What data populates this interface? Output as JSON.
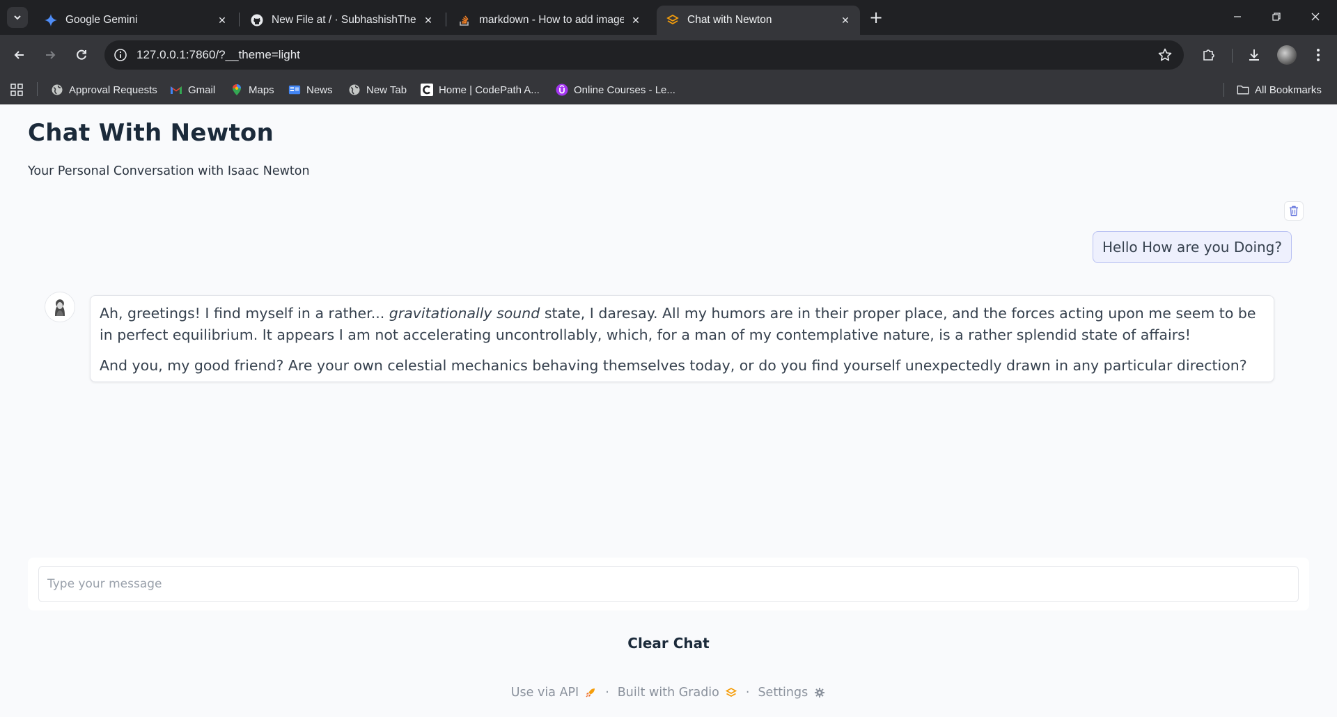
{
  "browser": {
    "tabs": [
      {
        "title": "Google Gemini",
        "icon": "gemini-icon",
        "active": false
      },
      {
        "title": "New File at / · SubhashishTheC",
        "icon": "github-icon",
        "active": false
      },
      {
        "title": "markdown - How to add image",
        "icon": "stackoverflow-icon",
        "active": false
      },
      {
        "title": "Chat with Newton",
        "icon": "gradio-icon",
        "active": true
      }
    ],
    "url": "127.0.0.1:7860/?__theme=light",
    "bookmarks": [
      {
        "label": "Approval Requests",
        "icon": "globe-icon"
      },
      {
        "label": "Gmail",
        "icon": "gmail-icon"
      },
      {
        "label": "Maps",
        "icon": "maps-icon"
      },
      {
        "label": "News",
        "icon": "news-icon"
      },
      {
        "label": "New Tab",
        "icon": "globe-icon"
      },
      {
        "label": "Home | CodePath A...",
        "icon": "codepath-icon"
      },
      {
        "label": "Online Courses - Le...",
        "icon": "udemy-icon"
      }
    ],
    "all_bookmarks_label": "All Bookmarks"
  },
  "app": {
    "title": "Chat With Newton",
    "subtitle": "Your Personal Conversation with Isaac Newton",
    "chat": {
      "user_message": "Hello How are you Doing?",
      "bot_message": {
        "p1_before": "Ah, greetings! I find myself in a rather... ",
        "p1_emphasis": "gravitationally sound",
        "p1_after": " state, I daresay. All my humors are in their proper place, and the forces acting upon me seem to be in perfect equilibrium. It appears I am not accelerating uncontrollably, which, for a man of my contemplative nature, is a rather splendid state of affairs!",
        "p2": "And you, my good friend? Are your own celestial mechanics behaving themselves today, or do you find yourself unexpectedly drawn in any particular direction?"
      }
    },
    "input": {
      "placeholder": "Type your message",
      "value": ""
    },
    "clear_button_label": "Clear Chat",
    "footer": {
      "api_label": "Use via API",
      "built_label": "Built with Gradio",
      "settings_label": "Settings",
      "separator": "·"
    }
  },
  "colors": {
    "chrome_dark": "#202124",
    "chrome_toolbar": "#35363a",
    "app_background": "#f9fafc",
    "user_bubble_bg": "#eef0fd",
    "user_bubble_border": "#b8c0f2",
    "gradio_orange": "#f59e0b"
  }
}
